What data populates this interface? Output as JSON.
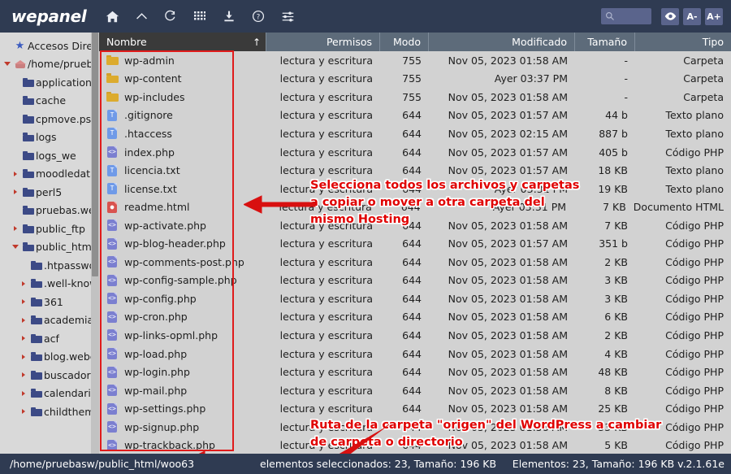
{
  "toolbar": {
    "brand": "wepanel",
    "icons": [
      {
        "name": "home-icon",
        "label": "Inicio"
      },
      {
        "name": "chevron-up-icon",
        "label": "Subir"
      },
      {
        "name": "refresh-icon",
        "label": "Recargar"
      },
      {
        "name": "grid-icon",
        "label": "Vista"
      },
      {
        "name": "download-icon",
        "label": "Descargar"
      },
      {
        "name": "help-icon",
        "label": "Ayuda"
      },
      {
        "name": "settings-sliders-icon",
        "label": "Ajustes"
      }
    ],
    "search_placeholder": "",
    "search_value": "",
    "eye_label": "",
    "font_decrease_label": "A-",
    "font_increase_label": "A+"
  },
  "sidebar": {
    "items": [
      {
        "label": "Accesos Direct",
        "icon": "star-icon",
        "depth": 0,
        "twisty": "none"
      },
      {
        "label": "/home/prueba",
        "icon": "home-icon",
        "depth": 0,
        "twisty": "open"
      },
      {
        "label": "application_",
        "icon": "folder-icon",
        "depth": 1,
        "twisty": "none"
      },
      {
        "label": "cache",
        "icon": "folder-icon",
        "depth": 1,
        "twisty": "none"
      },
      {
        "label": "cpmove.psql",
        "icon": "folder-icon",
        "depth": 1,
        "twisty": "none"
      },
      {
        "label": "logs",
        "icon": "folder-icon",
        "depth": 1,
        "twisty": "none"
      },
      {
        "label": "logs_we",
        "icon": "folder-icon",
        "depth": 1,
        "twisty": "none"
      },
      {
        "label": "moodledata",
        "icon": "folder-icon",
        "depth": 1,
        "twisty": "closed"
      },
      {
        "label": "perl5",
        "icon": "folder-icon",
        "depth": 1,
        "twisty": "closed"
      },
      {
        "label": "pruebas.web",
        "icon": "folder-icon",
        "depth": 1,
        "twisty": "none"
      },
      {
        "label": "public_ftp",
        "icon": "folder-icon",
        "depth": 1,
        "twisty": "closed"
      },
      {
        "label": "public_html",
        "icon": "folder-icon",
        "depth": 1,
        "twisty": "open"
      },
      {
        "label": ".htpasswd",
        "icon": "folder-icon",
        "depth": 2,
        "twisty": "none"
      },
      {
        "label": ".well-know",
        "icon": "folder-icon",
        "depth": 2,
        "twisty": "closed"
      },
      {
        "label": "361",
        "icon": "folder-icon",
        "depth": 2,
        "twisty": "closed"
      },
      {
        "label": "academia",
        "icon": "folder-icon",
        "depth": 2,
        "twisty": "closed"
      },
      {
        "label": "acf",
        "icon": "folder-icon",
        "depth": 2,
        "twisty": "closed"
      },
      {
        "label": "blog.weber",
        "icon": "folder-icon",
        "depth": 2,
        "twisty": "closed"
      },
      {
        "label": "buscadorw",
        "icon": "folder-icon",
        "depth": 2,
        "twisty": "closed"
      },
      {
        "label": "calendario",
        "icon": "folder-icon",
        "depth": 2,
        "twisty": "closed"
      },
      {
        "label": "childtheme",
        "icon": "folder-icon",
        "depth": 2,
        "twisty": "closed"
      }
    ]
  },
  "file_pane": {
    "columns": [
      {
        "key": "name",
        "label": "Nombre",
        "sort": "↑"
      },
      {
        "key": "perm",
        "label": "Permisos"
      },
      {
        "key": "modo",
        "label": "Modo"
      },
      {
        "key": "modif",
        "label": "Modificado"
      },
      {
        "key": "tam",
        "label": "Tamaño"
      },
      {
        "key": "tipo",
        "label": "Tipo"
      }
    ],
    "rows": [
      {
        "name": "wp-admin",
        "icon": "folder",
        "perm": "lectura y escritura",
        "modo": "755",
        "modif": "Nov 05, 2023 01:58 AM",
        "tam": "-",
        "tipo": "Carpeta"
      },
      {
        "name": "wp-content",
        "icon": "folder",
        "perm": "lectura y escritura",
        "modo": "755",
        "modif": "Ayer 03:37 PM",
        "tam": "-",
        "tipo": "Carpeta"
      },
      {
        "name": "wp-includes",
        "icon": "folder",
        "perm": "lectura y escritura",
        "modo": "755",
        "modif": "Nov 05, 2023 01:58 AM",
        "tam": "-",
        "tipo": "Carpeta"
      },
      {
        "name": ".gitignore",
        "icon": "txt",
        "perm": "lectura y escritura",
        "modo": "644",
        "modif": "Nov 05, 2023 01:57 AM",
        "tam": "44 b",
        "tipo": "Texto plano"
      },
      {
        "name": ".htaccess",
        "icon": "txt",
        "perm": "lectura y escritura",
        "modo": "644",
        "modif": "Nov 05, 2023 02:15 AM",
        "tam": "887 b",
        "tipo": "Texto plano"
      },
      {
        "name": "index.php",
        "icon": "php",
        "perm": "lectura y escritura",
        "modo": "644",
        "modif": "Nov 05, 2023 01:57 AM",
        "tam": "405 b",
        "tipo": "Código PHP"
      },
      {
        "name": "licencia.txt",
        "icon": "txt",
        "perm": "lectura y escritura",
        "modo": "644",
        "modif": "Nov 05, 2023 01:57 AM",
        "tam": "18 KB",
        "tipo": "Texto plano"
      },
      {
        "name": "license.txt",
        "icon": "txt",
        "perm": "lectura y escritura",
        "modo": "644",
        "modif": "Ayer 03:31 PM",
        "tam": "19 KB",
        "tipo": "Texto plano"
      },
      {
        "name": "readme.html",
        "icon": "html",
        "perm": "lectura y escritura",
        "modo": "644",
        "modif": "Ayer 03:31 PM",
        "tam": "7 KB",
        "tipo": "Documento HTML"
      },
      {
        "name": "wp-activate.php",
        "icon": "php",
        "perm": "lectura y escritura",
        "modo": "644",
        "modif": "Nov 05, 2023 01:58 AM",
        "tam": "7 KB",
        "tipo": "Código PHP"
      },
      {
        "name": "wp-blog-header.php",
        "icon": "php",
        "perm": "lectura y escritura",
        "modo": "644",
        "modif": "Nov 05, 2023 01:57 AM",
        "tam": "351 b",
        "tipo": "Código PHP"
      },
      {
        "name": "wp-comments-post.php",
        "icon": "php",
        "perm": "lectura y escritura",
        "modo": "644",
        "modif": "Nov 05, 2023 01:58 AM",
        "tam": "2 KB",
        "tipo": "Código PHP"
      },
      {
        "name": "wp-config-sample.php",
        "icon": "php",
        "perm": "lectura y escritura",
        "modo": "644",
        "modif": "Nov 05, 2023 01:58 AM",
        "tam": "3 KB",
        "tipo": "Código PHP"
      },
      {
        "name": "wp-config.php",
        "icon": "php",
        "perm": "lectura y escritura",
        "modo": "644",
        "modif": "Nov 05, 2023 01:58 AM",
        "tam": "3 KB",
        "tipo": "Código PHP"
      },
      {
        "name": "wp-cron.php",
        "icon": "php",
        "perm": "lectura y escritura",
        "modo": "644",
        "modif": "Nov 05, 2023 01:58 AM",
        "tam": "6 KB",
        "tipo": "Código PHP"
      },
      {
        "name": "wp-links-opml.php",
        "icon": "php",
        "perm": "lectura y escritura",
        "modo": "644",
        "modif": "Nov 05, 2023 01:58 AM",
        "tam": "2 KB",
        "tipo": "Código PHP"
      },
      {
        "name": "wp-load.php",
        "icon": "php",
        "perm": "lectura y escritura",
        "modo": "644",
        "modif": "Nov 05, 2023 01:58 AM",
        "tam": "4 KB",
        "tipo": "Código PHP"
      },
      {
        "name": "wp-login.php",
        "icon": "php",
        "perm": "lectura y escritura",
        "modo": "644",
        "modif": "Nov 05, 2023 01:58 AM",
        "tam": "48 KB",
        "tipo": "Código PHP"
      },
      {
        "name": "wp-mail.php",
        "icon": "php",
        "perm": "lectura y escritura",
        "modo": "644",
        "modif": "Nov 05, 2023 01:58 AM",
        "tam": "8 KB",
        "tipo": "Código PHP"
      },
      {
        "name": "wp-settings.php",
        "icon": "php",
        "perm": "lectura y escritura",
        "modo": "644",
        "modif": "Nov 05, 2023 01:58 AM",
        "tam": "25 KB",
        "tipo": "Código PHP"
      },
      {
        "name": "wp-signup.php",
        "icon": "php",
        "perm": "lectura y escritura",
        "modo": "644",
        "modif": "Nov 05, 2023 01:58 AM",
        "tam": "33 KB",
        "tipo": "Código PHP"
      },
      {
        "name": "wp-trackback.php",
        "icon": "php",
        "perm": "lectura y escritura",
        "modo": "644",
        "modif": "Nov 05, 2023 01:58 AM",
        "tam": "5 KB",
        "tipo": "Código PHP"
      }
    ]
  },
  "annotations": {
    "selection_note": [
      "Selecciona todos los archivos y carpetas",
      "a copiar o mover a otra carpeta del",
      "mismo Hosting"
    ],
    "path_note": [
      "Ruta de la carpeta \"origen\" del WordPress a cambiar",
      "de carpeta o directorio"
    ],
    "accent_color": "#e00000"
  },
  "status_bar": {
    "path": "/home/pruebasw/public_html/woo63",
    "selected": "elementos seleccionados: 23, Tamaño: 196 KB",
    "total": "Elementos: 23, Tamaño: 196 KB v.2.1.61e"
  }
}
